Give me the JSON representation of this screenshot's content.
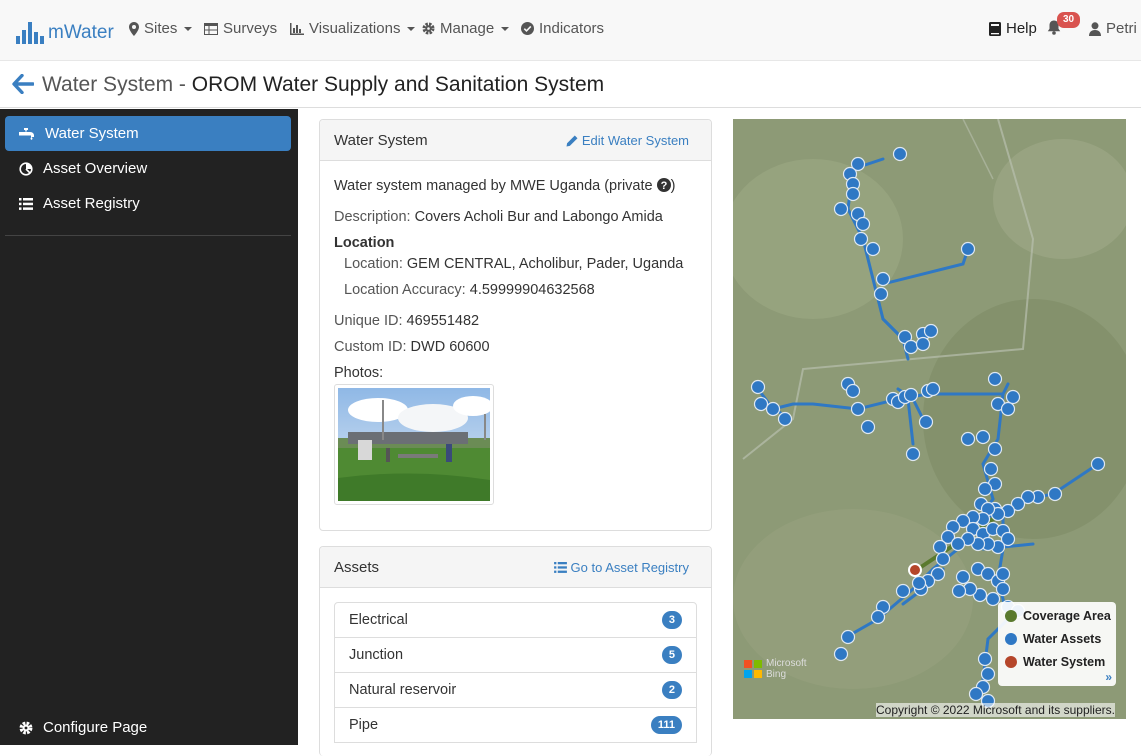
{
  "nav": {
    "brand": "mWater",
    "sites": "Sites",
    "surveys": "Surveys",
    "visualizations": "Visualizations",
    "manage": "Manage",
    "indicators": "Indicators",
    "help": "Help",
    "notifications": "30",
    "user": "Petri"
  },
  "header": {
    "section": "Water System",
    "separator": " - ",
    "name": "OROM Water Supply and Sanitation System"
  },
  "sidebar": {
    "items": [
      {
        "label": "Water System",
        "icon": "faucet-icon"
      },
      {
        "label": "Asset Overview",
        "icon": "chart-pie-icon"
      },
      {
        "label": "Asset Registry",
        "icon": "list-icon"
      }
    ],
    "configure": "Configure Page"
  },
  "water_system_panel": {
    "title": "Water System",
    "edit_link": "Edit Water System",
    "managed_by": "Water system managed by MWE Uganda (private",
    "managed_close": ")",
    "description_label": "Description:",
    "description": "Covers Acholi Bur and Labongo Amida",
    "location_heading": "Location",
    "location_label": "Location:",
    "location": "GEM CENTRAL, Acholibur, Pader, Uganda",
    "accuracy_label": "Location Accuracy:",
    "accuracy": "4.59999904632568",
    "unique_id_label": "Unique ID:",
    "unique_id": "469551482",
    "custom_id_label": "Custom ID:",
    "custom_id": "DWD 60600",
    "photos_label": "Photos:"
  },
  "assets_panel": {
    "title": "Assets",
    "registry_link": "Go to Asset Registry",
    "rows": [
      {
        "label": "Electrical",
        "count": "3"
      },
      {
        "label": "Junction",
        "count": "5"
      },
      {
        "label": "Natural reservoir",
        "count": "2"
      },
      {
        "label": "Pipe",
        "count": "111"
      }
    ]
  },
  "map": {
    "legend": [
      {
        "label": "Coverage Area",
        "color": "#5a7a2e"
      },
      {
        "label": "Water Assets",
        "color": "#2f78c4"
      },
      {
        "label": "Water System",
        "color": "#b5462a"
      }
    ],
    "legend_more": "»",
    "copyright": "Copyright © 2022 Microsoft and its suppliers.",
    "attribution_line1": "Microsoft",
    "attribution_line2": "Bing"
  }
}
